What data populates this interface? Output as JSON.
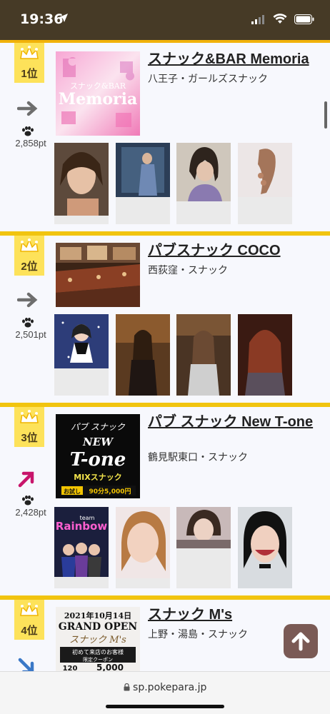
{
  "status_bar": {
    "time": "19:36"
  },
  "url_bar": {
    "domain": "sp.pokepara.jp"
  },
  "rankings": [
    {
      "rank": "1位",
      "trend": "same",
      "points": "2,858pt",
      "name": "スナック&BAR Memoria",
      "area": "八王子・ガールズスナック",
      "photo_text": {
        "line1": "スナック&BAR",
        "line2": "Memoria"
      }
    },
    {
      "rank": "2位",
      "trend": "same",
      "points": "2,501pt",
      "name": "パブスナック COCO",
      "area": "西荻窪・スナック"
    },
    {
      "rank": "3位",
      "trend": "up",
      "points": "2,428pt",
      "name": "パブ スナック New T-one",
      "area": "鶴見駅東口・スナック",
      "photo_text": {
        "line1": "パブ スナック",
        "line2": "NEW",
        "line3": "T-one",
        "line4": "MIXスナック",
        "line5": "お試し 90分5,000円"
      },
      "girl_photo_text": {
        "line1": "team",
        "line2": "Rainbow"
      }
    },
    {
      "rank": "4位",
      "trend": "down",
      "points": "",
      "name": "スナック M's",
      "area": "上野・湯島・スナック",
      "photo_text": {
        "line1": "2021年10月14日",
        "line2": "GRAND OPEN",
        "line3": "スナック M's",
        "line4": "初めて来店のお客様",
        "line5": "限定クーポン",
        "line6": "120 5,000"
      }
    }
  ],
  "colors": {
    "gold": "#f1c40f",
    "badge": "#fde25a",
    "status_bg": "#463a26",
    "trend_same": "#6e6e6e",
    "trend_up": "#c8156b",
    "trend_down": "#3a78c7"
  }
}
